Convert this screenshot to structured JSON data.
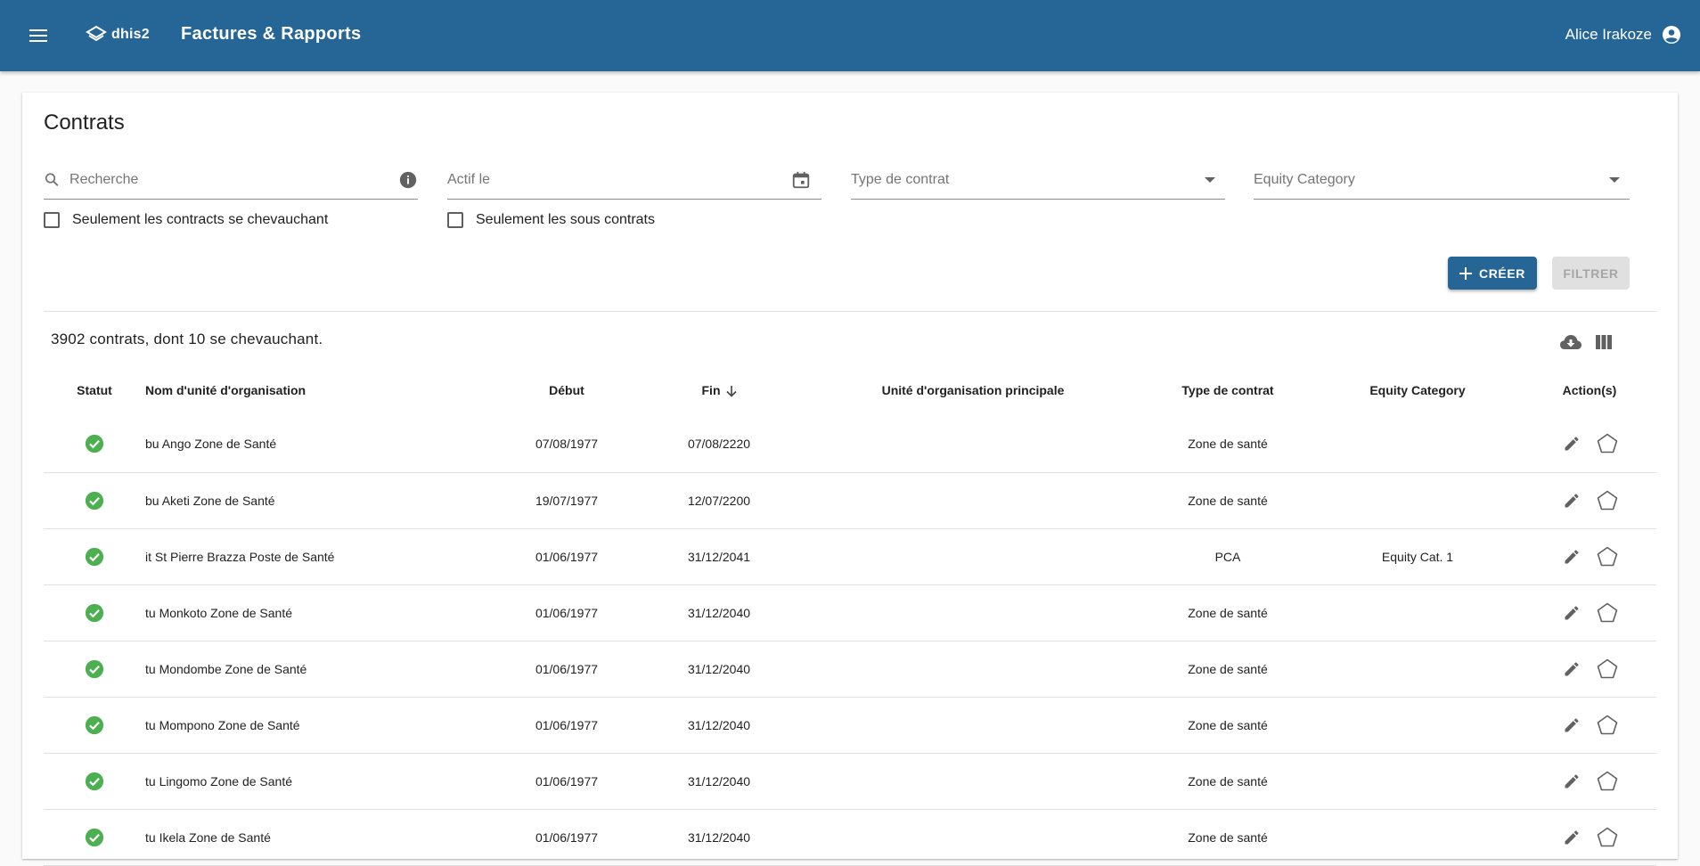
{
  "app": {
    "logo_text": "dhis2",
    "title": "Factures & Rapports",
    "user_name": "Alice Irakoze"
  },
  "page": {
    "title": "Contrats"
  },
  "filters": {
    "search_placeholder": "Recherche",
    "active_on_label": "Actif le",
    "contract_type_label": "Type de contrat",
    "equity_category_label": "Equity Category",
    "overlapping_label": "Seulement les contracts se chevauchant",
    "sub_contracts_label": "Seulement les sous contrats"
  },
  "buttons": {
    "create": "CRÉER",
    "filter": "FILTRER"
  },
  "summary": "3902 contrats, dont 10 se chevauchant.",
  "table": {
    "columns": {
      "status": "Statut",
      "org_unit": "Nom d'unité d'organisation",
      "start": "Début",
      "end": "Fin",
      "main_org_unit": "Unité d'organisation principale",
      "contract_type": "Type de contrat",
      "equity_category": "Equity Category",
      "actions": "Action(s)"
    },
    "rows": [
      {
        "org_unit": "bu Ango Zone de Santé",
        "start": "07/08/1977",
        "end": "07/08/2220",
        "main_org_unit": "",
        "contract_type": "Zone de santé",
        "equity_category": ""
      },
      {
        "org_unit": "bu Aketi Zone de Santé",
        "start": "19/07/1977",
        "end": "12/07/2200",
        "main_org_unit": "",
        "contract_type": "Zone de santé",
        "equity_category": ""
      },
      {
        "org_unit": "it St Pierre Brazza Poste de Santé",
        "start": "01/06/1977",
        "end": "31/12/2041",
        "main_org_unit": "",
        "contract_type": "PCA",
        "equity_category": "Equity Cat. 1"
      },
      {
        "org_unit": "tu Monkoto Zone de Santé",
        "start": "01/06/1977",
        "end": "31/12/2040",
        "main_org_unit": "",
        "contract_type": "Zone de santé",
        "equity_category": ""
      },
      {
        "org_unit": "tu Mondombe Zone de Santé",
        "start": "01/06/1977",
        "end": "31/12/2040",
        "main_org_unit": "",
        "contract_type": "Zone de santé",
        "equity_category": ""
      },
      {
        "org_unit": "tu Mompono Zone de Santé",
        "start": "01/06/1977",
        "end": "31/12/2040",
        "main_org_unit": "",
        "contract_type": "Zone de santé",
        "equity_category": ""
      },
      {
        "org_unit": "tu Lingomo Zone de Santé",
        "start": "01/06/1977",
        "end": "31/12/2040",
        "main_org_unit": "",
        "contract_type": "Zone de santé",
        "equity_category": ""
      },
      {
        "org_unit": "tu Ikela Zone de Santé",
        "start": "01/06/1977",
        "end": "31/12/2040",
        "main_org_unit": "",
        "contract_type": "Zone de santé",
        "equity_category": ""
      }
    ]
  },
  "colors": {
    "primary": "#266696",
    "status_ok": "#4caf50",
    "icon_grey": "#616161"
  },
  "icons": {
    "menu": "menu-icon",
    "logo": "dhis2-logo-icon",
    "user": "account-circle-icon",
    "search": "search-icon",
    "info": "info-icon",
    "calendar": "calendar-icon",
    "dropdown": "arrow-drop-down-icon",
    "download": "cloud-download-icon",
    "columns": "view-column-icon",
    "status": "check-circle-icon",
    "edit": "edit-icon",
    "shape": "pentagon-icon",
    "add": "plus-icon",
    "sort": "arrow-down-icon"
  }
}
